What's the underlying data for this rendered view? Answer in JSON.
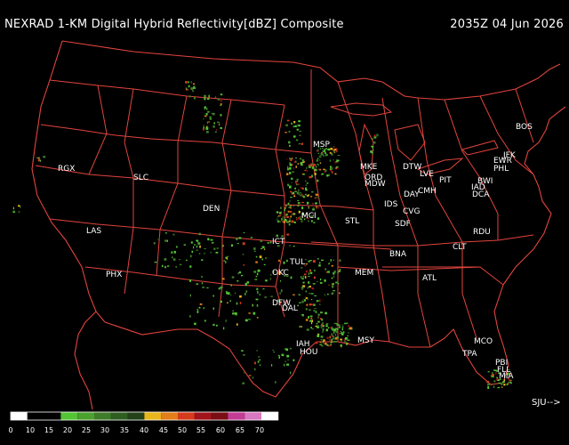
{
  "header": {
    "title": "NEXRAD 1-KM Digital Hybrid Reflectivity[dBZ] Composite",
    "timestamp": "2035Z 04 Jun 2026"
  },
  "cities": [
    "MSP",
    "MKE",
    "DTW",
    "ORD",
    "MDW",
    "LVE",
    "CMH",
    "PIT",
    "DAY",
    "IDS",
    "CVG",
    "SDF",
    "STL",
    "MCI",
    "ICT",
    "OKC",
    "TUL",
    "DFW",
    "DAL",
    "IAH",
    "HOU",
    "MSY",
    "MEM",
    "BNA",
    "ATL",
    "CLT",
    "RDU",
    "TPA",
    "MCO",
    "PBI",
    "FLL",
    "MIA",
    "BOS",
    "JFK",
    "EWR",
    "PHL",
    "BWI",
    "IAD",
    "DCA",
    "RGX",
    "SLC",
    "DEN",
    "LAS",
    "PHX"
  ],
  "offscreen_link": {
    "label": "SJU",
    "arrow": "-->"
  },
  "legend": {
    "colors": [
      "#ffffff",
      "#000000",
      "#000000",
      "#54c435",
      "#4aa12e",
      "#3f7c2a",
      "#2f5e21",
      "#23421a",
      "#e8b51c",
      "#e37f1a",
      "#d63a1c",
      "#a3131c",
      "#7a0e14",
      "#c33c95",
      "#d977c1",
      "#ffffff"
    ],
    "ticks": [
      "0",
      "10",
      "15",
      "20",
      "25",
      "30",
      "35",
      "40",
      "45",
      "50",
      "55",
      "60",
      "65",
      "70"
    ]
  }
}
